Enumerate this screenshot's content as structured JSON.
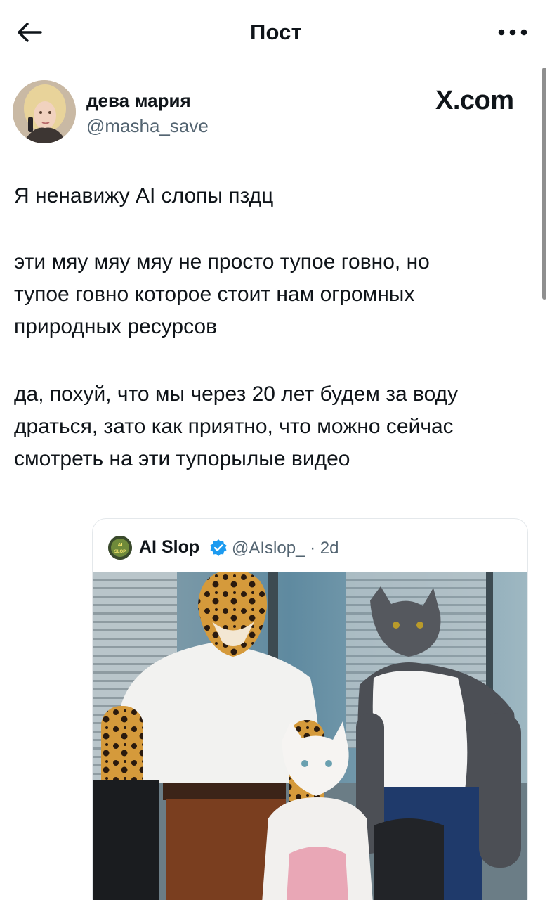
{
  "header": {
    "title": "Пост",
    "back_icon": "arrow-left-icon",
    "more_icon": "more-horizontal-icon"
  },
  "author": {
    "name": "дева мария",
    "handle": "@masha_save",
    "watermark": "X.com"
  },
  "post": {
    "paragraphs": [
      [
        "Я ненавижу AI слопы пздц"
      ],
      [
        "эти мяу мяу мяу не просто тупое говно, но",
        "тупое говно которое стоит нам огромных",
        "природных ресурсов"
      ],
      [
        "да, похуй, что мы через 20 лет будем за воду",
        "драться, зато как приятно, что можно сейчас",
        "смотреть на эти тупорылые видео"
      ]
    ]
  },
  "quote": {
    "name": "AI Slop",
    "handle_time": "@AIslop_ · 2d",
    "avatar_text": "AI SLOP",
    "verified_color": "#1d9bf0"
  },
  "colors": {
    "text": "#0f1419",
    "secondary": "#536471",
    "border": "#e4e8eb"
  }
}
